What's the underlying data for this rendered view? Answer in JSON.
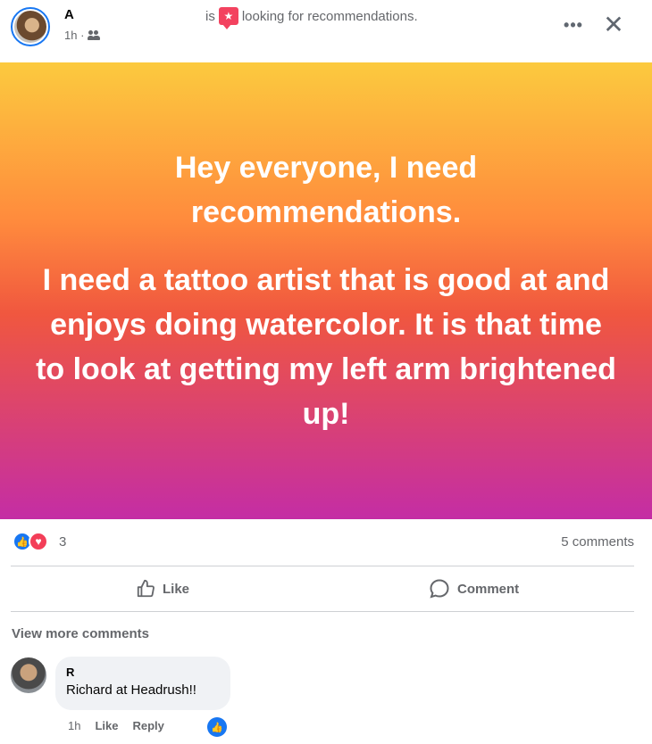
{
  "post": {
    "author": "A",
    "status_verb": "is",
    "status_text": "looking for recommendations.",
    "time": "1h ·",
    "audience_icon": "friends-icon",
    "more_label": "•••",
    "close_label": "✕"
  },
  "banner": {
    "line1": "Hey everyone, I need recommendations.",
    "line2": "I need a tattoo artist that is good at and enjoys doing watercolor. It is that time to look at getting my left arm brightened up!",
    "gradient": [
      "#fcca3e",
      "#ff8a3d",
      "#f0573f",
      "#c42da5"
    ]
  },
  "stats": {
    "reaction_count": "3",
    "comments_count": "5 comments"
  },
  "actions": {
    "like_label": "Like",
    "comment_label": "Comment"
  },
  "comments": {
    "view_more": "View more comments",
    "items": [
      {
        "author": "R",
        "text": "Richard at Headrush!!",
        "time": "1h",
        "like_label": "Like",
        "reply_label": "Reply"
      }
    ]
  },
  "colors": {
    "brand": "#1877f2",
    "love": "#f33e58",
    "muted_text": "#65676b"
  }
}
